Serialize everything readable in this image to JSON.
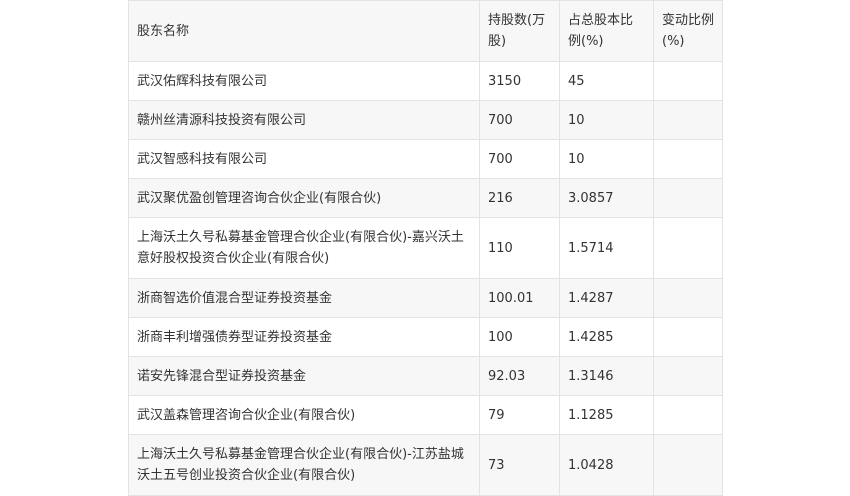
{
  "table": {
    "headers": [
      "股东名称",
      "持股数(万股)",
      "占总股本比例(%)",
      "变动比例(%)"
    ],
    "rows": [
      [
        "武汉佑辉科技有限公司",
        "3150",
        "45",
        ""
      ],
      [
        "赣州丝清源科技投资有限公司",
        "700",
        "10",
        ""
      ],
      [
        "武汉智感科技有限公司",
        "700",
        "10",
        ""
      ],
      [
        "武汉聚优盈创管理咨询合伙企业(有限合伙)",
        "216",
        "3.0857",
        ""
      ],
      [
        "上海沃土久号私募基金管理合伙企业(有限合伙)-嘉兴沃土意好股权投资合伙企业(有限合伙)",
        "110",
        "1.5714",
        ""
      ],
      [
        "浙商智选价值混合型证券投资基金",
        "100.01",
        "1.4287",
        ""
      ],
      [
        "浙商丰利增强债券型证券投资基金",
        "100",
        "1.4285",
        ""
      ],
      [
        "诺安先锋混合型证券投资基金",
        "92.03",
        "1.3146",
        ""
      ],
      [
        "武汉盖森管理咨询合伙企业(有限合伙)",
        "79",
        "1.1285",
        ""
      ],
      [
        "上海沃土久号私募基金管理合伙企业(有限合伙)-江苏盐城沃土五号创业投资合伙企业(有限合伙)",
        "73",
        "1.0428",
        ""
      ]
    ]
  }
}
